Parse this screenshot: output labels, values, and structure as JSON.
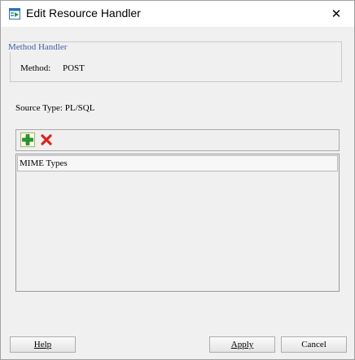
{
  "window": {
    "title": "Edit Resource Handler",
    "close_glyph": "✕",
    "icon": "app-icon"
  },
  "method_handler": {
    "legend": "Method Handler",
    "method_label": "Method:",
    "method_value": "POST"
  },
  "source_type": {
    "label": "Source Type:",
    "value": "PL/SQL"
  },
  "toolbar": {
    "add_icon": "plus-icon",
    "remove_icon": "delete-x-icon"
  },
  "mime_table": {
    "header": "MIME Types",
    "rows": []
  },
  "buttons": {
    "help": "Help",
    "apply": "Apply",
    "cancel": "Cancel"
  },
  "colors": {
    "legend_text": "#3b5fa8",
    "add_green": "#2e9b2e",
    "delete_red": "#d9231c"
  }
}
